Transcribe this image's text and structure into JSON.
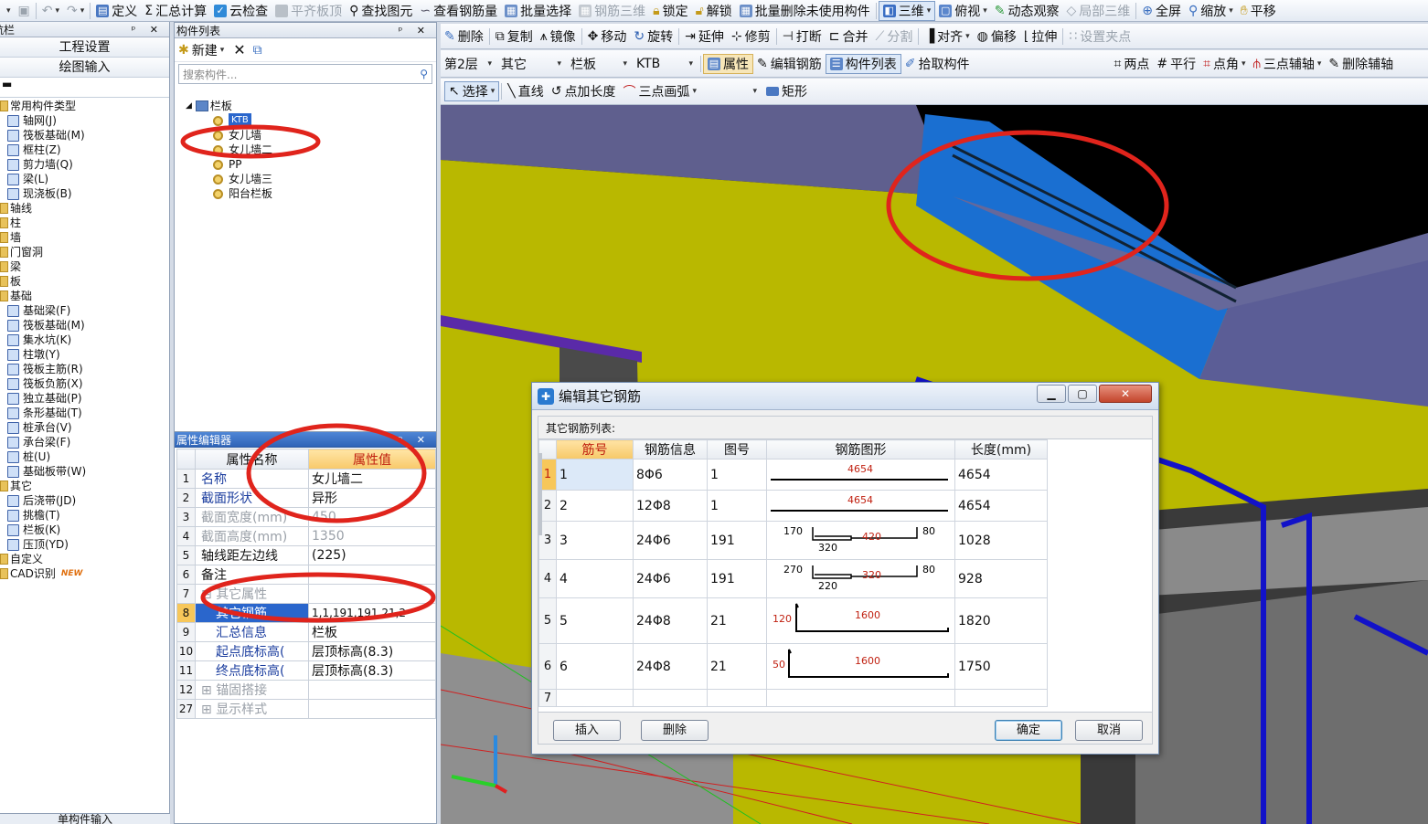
{
  "top_toolbar": {
    "items": [
      "定义",
      "汇总计算",
      "云检查",
      "平齐板顶",
      "查找图元",
      "查看钢筋量",
      "批量选择",
      "钢筋三维",
      "锁定",
      "解锁",
      "批量删除未使用构件",
      "三维",
      "俯视",
      "动态观察",
      "局部三维",
      "全屏",
      "缩放",
      "平移"
    ],
    "disabled": [
      3,
      7,
      14
    ]
  },
  "edit_toolbar": {
    "items": [
      "删除",
      "复制",
      "镜像",
      "移动",
      "旋转",
      "延伸",
      "修剪",
      "打断",
      "合并",
      "分割",
      "对齐",
      "偏移",
      "拉伸",
      "设置夹点"
    ]
  },
  "layer_toolbar": {
    "floor": "第2层",
    "category": "其它",
    "type": "栏板",
    "component": "KTB",
    "buttons": [
      "属性",
      "编辑钢筋",
      "构件列表",
      "拾取构件"
    ],
    "axis_buttons": [
      "两点",
      "平行",
      "点角",
      "三点辅轴",
      "删除辅轴"
    ]
  },
  "draw_toolbar": {
    "items": [
      "选择",
      "直线",
      "点加长度",
      "三点画弧",
      "矩形"
    ]
  },
  "nav": {
    "title": "导航栏",
    "buttons": [
      "工程设置",
      "绘图输入"
    ],
    "tree": [
      {
        "label": "常用构件类型",
        "level": 0,
        "folder": true
      },
      {
        "label": "轴网(J)",
        "level": 1
      },
      {
        "label": "筏板基础(M)",
        "level": 1
      },
      {
        "label": "框柱(Z)",
        "level": 1
      },
      {
        "label": "剪力墙(Q)",
        "level": 1
      },
      {
        "label": "梁(L)",
        "level": 1
      },
      {
        "label": "现浇板(B)",
        "level": 1
      },
      {
        "label": "轴线",
        "level": 0,
        "folder": true
      },
      {
        "label": "柱",
        "level": 0,
        "folder": true
      },
      {
        "label": "墙",
        "level": 0,
        "folder": true
      },
      {
        "label": "门窗洞",
        "level": 0,
        "folder": true
      },
      {
        "label": "梁",
        "level": 0,
        "folder": true
      },
      {
        "label": "板",
        "level": 0,
        "folder": true
      },
      {
        "label": "基础",
        "level": 0,
        "folder": true
      },
      {
        "label": "基础梁(F)",
        "level": 1
      },
      {
        "label": "筏板基础(M)",
        "level": 1
      },
      {
        "label": "集水坑(K)",
        "level": 1
      },
      {
        "label": "柱墩(Y)",
        "level": 1
      },
      {
        "label": "筏板主筋(R)",
        "level": 1
      },
      {
        "label": "筏板负筋(X)",
        "level": 1
      },
      {
        "label": "独立基础(P)",
        "level": 1
      },
      {
        "label": "条形基础(T)",
        "level": 1
      },
      {
        "label": "桩承台(V)",
        "level": 1
      },
      {
        "label": "承台梁(F)",
        "level": 1
      },
      {
        "label": "桩(U)",
        "level": 1
      },
      {
        "label": "基础板带(W)",
        "level": 1
      },
      {
        "label": "其它",
        "level": 0,
        "folder": true
      },
      {
        "label": "后浇带(JD)",
        "level": 1
      },
      {
        "label": "挑檐(T)",
        "level": 1
      },
      {
        "label": "栏板(K)",
        "level": 1
      },
      {
        "label": "压顶(YD)",
        "level": 1
      },
      {
        "label": "自定义",
        "level": 0,
        "folder": true
      },
      {
        "label": "CAD识别",
        "level": 0,
        "folder": true
      }
    ],
    "new_badge": "NEW",
    "bottom": "单构件输入"
  },
  "component_list": {
    "title": "构件列表",
    "new_label": "新建",
    "search_placeholder": "搜索构件...",
    "root": "栏板",
    "items": [
      "KTB",
      "女儿墙",
      "女儿墙二",
      "PP",
      "女儿墙三",
      "阳台栏板"
    ]
  },
  "property_editor": {
    "title": "属性编辑器",
    "col_name": "属性名称",
    "col_value": "属性值",
    "rows": [
      {
        "n": "1",
        "k": "名称",
        "v": "女儿墙二"
      },
      {
        "n": "2",
        "k": "截面形状",
        "v": "异形"
      },
      {
        "n": "3",
        "k": "截面宽度(mm)",
        "v": "450"
      },
      {
        "n": "4",
        "k": "截面高度(mm)",
        "v": "1350"
      },
      {
        "n": "5",
        "k": "轴线距左边线",
        "v": "(225)"
      },
      {
        "n": "6",
        "k": "备注",
        "v": ""
      },
      {
        "n": "7",
        "k": "其它属性",
        "v": ""
      },
      {
        "n": "8",
        "k": "其它钢筋",
        "v": "1,1,191,191,21,2"
      },
      {
        "n": "9",
        "k": "汇总信息",
        "v": "栏板"
      },
      {
        "n": "10",
        "k": "起点底标高(",
        "v": "层顶标高(8.3)"
      },
      {
        "n": "11",
        "k": "终点底标高(",
        "v": "层顶标高(8.3)"
      },
      {
        "n": "12",
        "k": "锚固搭接",
        "v": ""
      },
      {
        "n": "27",
        "k": "显示样式",
        "v": ""
      }
    ]
  },
  "dialog": {
    "title": "编辑其它钢筋",
    "list_label": "其它钢筋列表:",
    "columns": [
      "筋号",
      "钢筋信息",
      "图号",
      "钢筋图形",
      "长度(mm)"
    ],
    "rows": [
      {
        "n": "1",
        "id": "1",
        "info": "8Φ6",
        "fig": "1",
        "len": "4654",
        "shape": {
          "kind": "line",
          "label": "4654"
        }
      },
      {
        "n": "2",
        "id": "2",
        "info": "12Φ8",
        "fig": "1",
        "len": "4654",
        "shape": {
          "kind": "line",
          "label": "4654"
        }
      },
      {
        "n": "3",
        "id": "3",
        "info": "24Φ6",
        "fig": "191",
        "len": "1028",
        "shape": {
          "kind": "u",
          "a": "170",
          "b": "320",
          "c": "420",
          "d": "80"
        }
      },
      {
        "n": "4",
        "id": "4",
        "info": "24Φ6",
        "fig": "191",
        "len": "928",
        "shape": {
          "kind": "u",
          "a": "270",
          "b": "220",
          "c": "320",
          "d": "80"
        }
      },
      {
        "n": "5",
        "id": "5",
        "info": "24Φ8",
        "fig": "21",
        "len": "1820",
        "shape": {
          "kind": "hook",
          "a": "120",
          "c": "1600"
        }
      },
      {
        "n": "6",
        "id": "6",
        "info": "24Φ8",
        "fig": "21",
        "len": "1750",
        "shape": {
          "kind": "hook",
          "a": "50",
          "c": "1600"
        }
      },
      {
        "n": "7",
        "id": "",
        "info": "",
        "fig": "",
        "len": "",
        "shape": {
          "kind": "none"
        }
      }
    ],
    "buttons": {
      "insert": "插入",
      "delete": "删除",
      "ok": "确定",
      "cancel": "取消"
    }
  },
  "colors": {
    "accent": "#2a66cc",
    "highlight": "#f7c75a",
    "annotation": "#e0241c"
  }
}
